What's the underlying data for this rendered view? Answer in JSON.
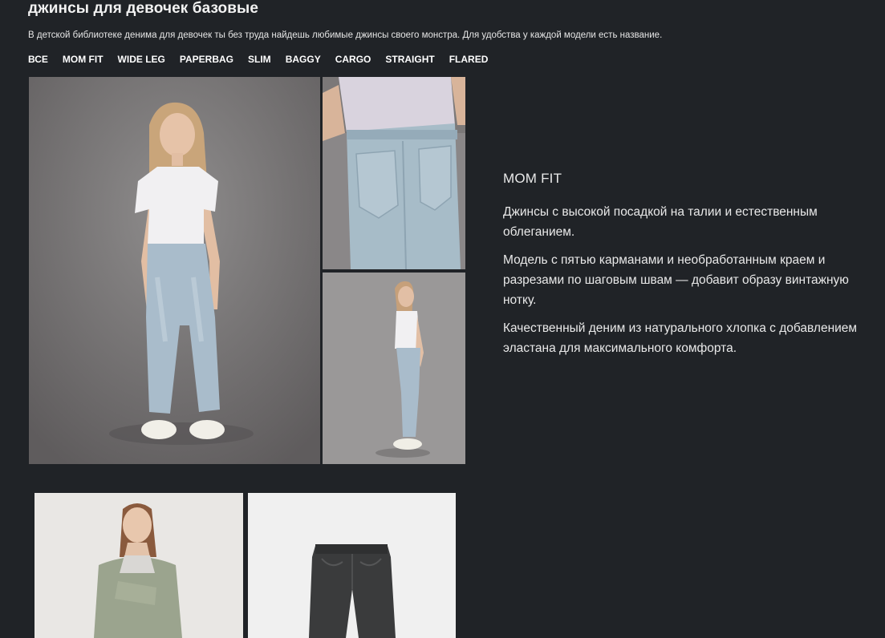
{
  "page": {
    "title": "джинсы для девочек базовые",
    "subtitle": "В детской библиотеке денима для девочек ты без труда найдешь любимые джинсы своего монстра. Для удобства у каждой модели есть название."
  },
  "filters": [
    "ВСЕ",
    "MOM FIT",
    "WIDE LEG",
    "PAPERBAG",
    "SLIM",
    "BAGGY",
    "CARGO",
    "STRAIGHT",
    "FLARED"
  ],
  "model": {
    "name": "MOM FIT",
    "paragraphs": [
      "Джинсы с высокой посадкой на талии и естественным облеганием.",
      "Модель с пятью карманами и необработанным краем и разрезами по шаговым швам — добавит образу винтажную нотку.",
      "Качественный деним из натурального хлопка с добавлением эластана для максимального комфорта."
    ]
  },
  "colors": {
    "background": "#202327",
    "text": "#ffffff"
  }
}
